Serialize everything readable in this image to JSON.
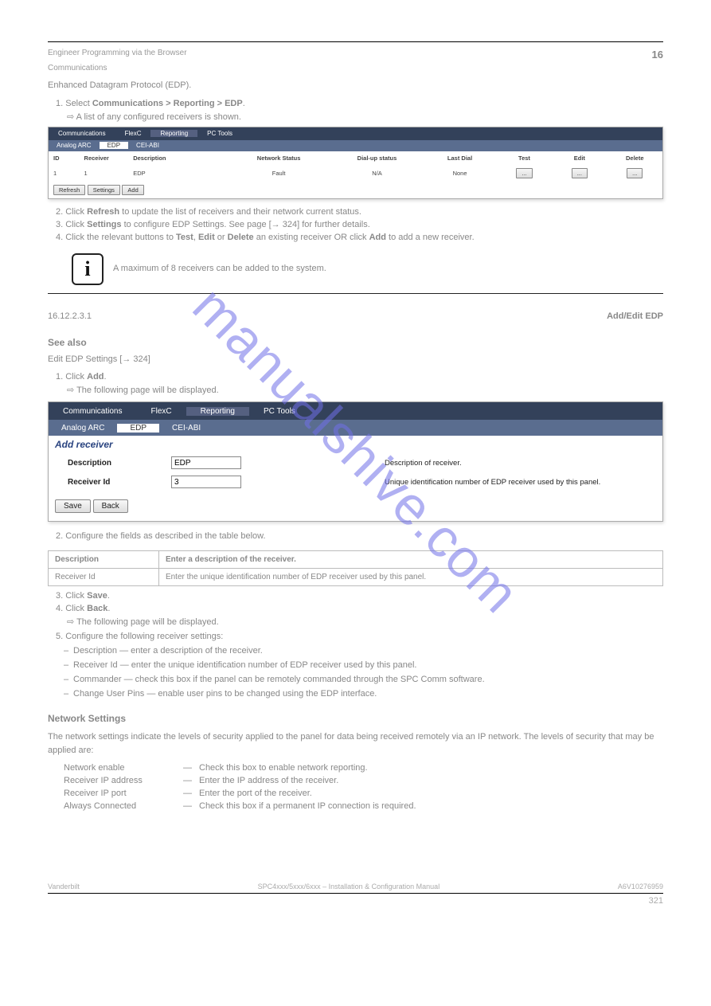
{
  "header": {
    "left": "Engineer Programming via the Browser",
    "right": "16",
    "sub": "Communications"
  },
  "intro": "Enhanced Datagram Protocol (EDP).",
  "step1_prefix": "1.  Select ",
  "step1_b1": "Communications > Reporting > EDP",
  "step1_suffix": ".",
  "arrow1": "⇨  A list of any configured receivers is shown.",
  "shot1": {
    "nav": [
      "Communications",
      "FlexC",
      "Reporting",
      "PC Tools"
    ],
    "subnav": [
      "Analog ARC",
      "EDP",
      "CEI-ABI"
    ],
    "cols": [
      "ID",
      "Receiver",
      "Description",
      "Network Status",
      "Dial-up status",
      "Last Dial",
      "Test",
      "Edit",
      "Delete"
    ],
    "row": [
      "1",
      "1",
      "EDP",
      "Fault",
      "N/A",
      "None",
      "...",
      "...",
      "..."
    ],
    "btns": [
      "Refresh",
      "Settings",
      "Add"
    ]
  },
  "step2": "2.  Click ",
  "step2_b": "Refresh",
  "step2_end": " to update the list of receivers and their network current status.",
  "step3": "3.  Click ",
  "step3_b": "Settings",
  "step3_end": " to configure EDP Settings. See page [→ 324] for further details.",
  "step4": "4.  Click the relevant buttons to ",
  "step4_b1": "Test",
  "step4_mid1": ", ",
  "step4_b2": "Edit",
  "step4_mid2": " or ",
  "step4_b3": "Delete",
  "step4_end": " an existing receiver OR click ",
  "step4_b4": "Add",
  "step4_end2": " to add a new receiver.",
  "info": "A maximum of 8 receivers can be added to the system.",
  "hr_note": "",
  "subsection": {
    "num": "16.12.2.3.1",
    "title": "Add/Edit EDP"
  },
  "see": "See also",
  "see_item": "Edit EDP Settings [→ 324]",
  "step_add1": "1.  Click ",
  "step_add1_b": "Add",
  "step_add1_end": ".",
  "arrow2": "⇨  The following page will be displayed.",
  "shot2": {
    "nav": [
      "Communications",
      "FlexC",
      "Reporting",
      "PC Tools"
    ],
    "subnav": [
      "Analog ARC",
      "EDP",
      "CEI-ABI"
    ],
    "title": "Add receiver",
    "fields": {
      "desc_label": "Description",
      "desc_value": "EDP",
      "desc_help": "Description of receiver.",
      "id_label": "Receiver Id",
      "id_value": "3",
      "id_help": "Unique identification number of EDP receiver used by this panel."
    },
    "btns": [
      "Save",
      "Back"
    ]
  },
  "step_add2": "2.  Configure the fields as described in the table below.",
  "table_head": [
    "Description",
    "Enter a description of the receiver."
  ],
  "table_row": [
    "Receiver Id",
    "Enter the unique identification number of EDP receiver used by this panel."
  ],
  "step_add3": "3.  Click ",
  "step_add3_b": "Save",
  "step_add3_end": ".",
  "step_add4": "4.  Click ",
  "step_add4_b": "Back",
  "step_add4_end": ".",
  "arrow3": "⇨  The following page will be displayed.",
  "step_conf5": "5.  Configure the following receiver settings:",
  "bullets": [
    "Description — enter a description of the receiver.",
    "Receiver Id — enter the unique identification number of EDP receiver used by this panel.",
    "Commander — check this box if the panel can be remotely commanded through the SPC Comm software.",
    "Change User Pins — enable user pins to be changed using the EDP interface."
  ],
  "network_heading": "Network Settings",
  "network_text": "The network settings indicate the levels of security applied to the panel for data being received remotely via an IP network. The levels of security that may be applied are:",
  "levels": [
    {
      "name": "Network enable",
      "arrow": "—",
      "desc": "Check this box to enable network reporting."
    },
    {
      "name": "Receiver IP address",
      "arrow": "—",
      "desc": "Enter the IP address of the receiver."
    },
    {
      "name": "Receiver IP port",
      "arrow": "—",
      "desc": "Enter the port of the receiver."
    },
    {
      "name": "Always Connected",
      "arrow": "—",
      "desc": "Check this box if a permanent IP connection is required."
    }
  ],
  "footer": {
    "left": "Vanderbilt",
    "right": "A6V10276959",
    "page": "321",
    "docmid": "SPC4xxx/5xxx/6xxx – Installation & Configuration Manual"
  },
  "watermark": "manualshive.com"
}
